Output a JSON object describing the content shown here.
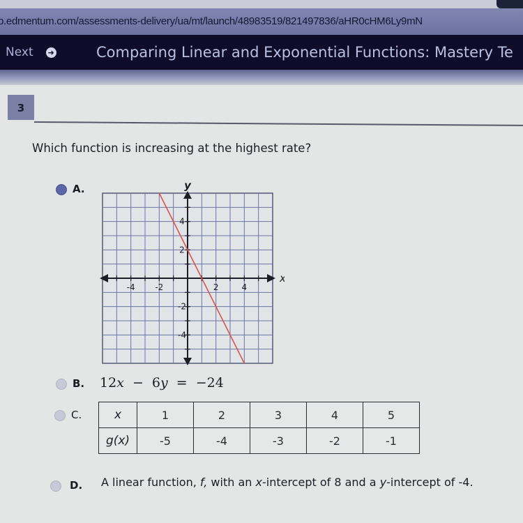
{
  "browser": {
    "url": "p.edmentum.com/assessments-delivery/ua/mt/launch/48983519/821497836/aHR0cHM6Ly9mN"
  },
  "nav": {
    "next_label": "Next",
    "next_icon": "arrow-circle-right-icon",
    "title": "Comparing Linear and Exponential Functions: Mastery Te"
  },
  "question": {
    "number": "3",
    "text": "Which function is increasing at the highest rate?",
    "selected_option": "A"
  },
  "options": {
    "a": {
      "label": "A.",
      "graph": {
        "x_axis_label": "x",
        "y_axis_label": "y",
        "x_range": [
          -6,
          6
        ],
        "y_range": [
          -6,
          6
        ],
        "x_tick_labels": [
          "-4",
          "-2",
          "2",
          "4"
        ],
        "y_tick_labels": [
          "4",
          "2",
          "-2",
          "-4"
        ],
        "line": {
          "slope": -2,
          "intercept": 2,
          "color": "#d9534f"
        }
      }
    },
    "b": {
      "label": "B.",
      "equation": {
        "lhs1": "12",
        "var1": "x",
        "op": "−",
        "lhs2": "6",
        "var2": "y",
        "eq": "=",
        "rhs": "−24"
      }
    },
    "c": {
      "label": "C.",
      "table": {
        "row_headers": [
          "x",
          "g(x)"
        ],
        "x": [
          "1",
          "2",
          "3",
          "4",
          "5"
        ],
        "gx": [
          "-5",
          "-4",
          "-3",
          "-2",
          "-1"
        ]
      }
    },
    "d": {
      "label": "D.",
      "text_parts": {
        "p1": "A linear function, ",
        "f": "f,",
        "p2": " with an ",
        "x": "x",
        "p3": "-intercept of 8 and a ",
        "y": "y",
        "p4": "-intercept of -4."
      }
    }
  },
  "colors": {
    "nav_bg": "#0f0c2a",
    "url_bar_bg": "#7f86b0",
    "question_badge_bg": "#7b80a4",
    "radio_selected": "#5a66a8",
    "graph_line": "#d9534f"
  }
}
